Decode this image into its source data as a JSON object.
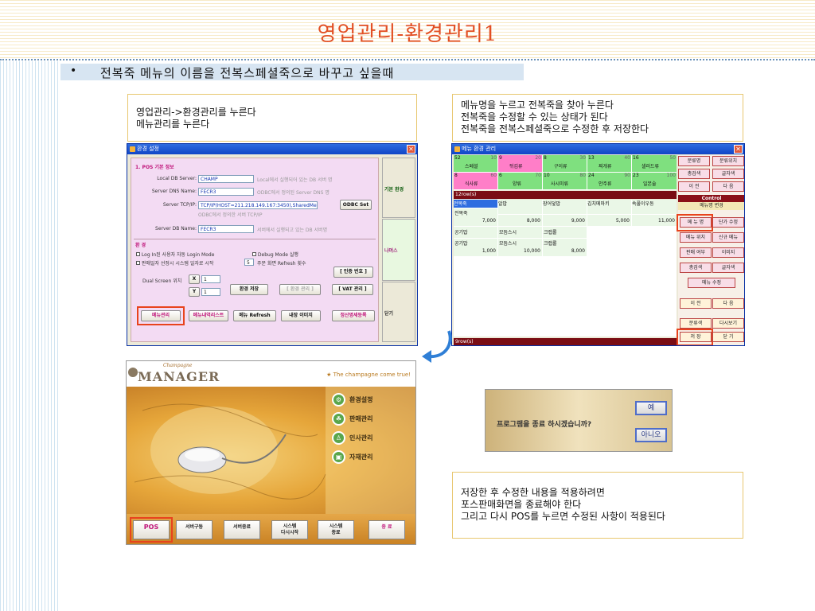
{
  "slide": {
    "title": "영업관리-환경관리1",
    "bullet": "•",
    "bullet_text": "전복죽 메뉴의 이름을 전복스페셜죽으로 바꾸고 싶을때"
  },
  "note_left": {
    "line1": "영업관리->환경관리를 누른다",
    "line2": "메뉴관리를 누른다"
  },
  "note_right": {
    "line1": "메뉴명을 누르고 전복죽을 찾아 누른다",
    "line2": "전복죽을 수정할 수 있는 상태가 된다",
    "line3": "전복죽을 전복스페셜죽으로 수정한 후 저장한다"
  },
  "note_bottom": {
    "line1": "저장한 후 수정한 내용을 적용하려면",
    "line2": "포스판매화면을 종료해야 한다",
    "line3": "그리고 다시 POS를 누르면 수정된 사항이 적용된다"
  },
  "env_window": {
    "title": "환경 설정",
    "section1": "1. POS 기본 정보",
    "local_db_label": "Local DB Server:",
    "local_db_value": "CHAMP",
    "local_db_hint": "Local에서 실행되어 있는 DB 서버 명",
    "dsn_label": "Server DNS Name:",
    "dsn_value": "FECR3",
    "dsn_hint": "ODBC에서 정의된 Server DNS 명",
    "tcp_label": "Server TCP/IP:",
    "tcp_value": "TCP/IP(HOST=211.218.149.167:3450),SharedMemory)",
    "tcp_hint": "ODBC에서 정의한 서버 TCP/IP",
    "odbc_btn": "ODBC Set",
    "dbname_label": "Server DB Name:",
    "dbname_value": "FECR3",
    "dbname_hint": "서버에서 실행되고 있는 DB 서버명",
    "section2": "환 경",
    "opt1": "Log In된 사용자 자동 Login Mode",
    "opt2": "Debug Mode 실행",
    "opt3": "판매일자 선정시 시스템 일자로 시작",
    "opt4_num": "5",
    "opt4": "주문 화면 Refresh 횟수",
    "dual_label": "Dual Screen 위치",
    "x_label": "X",
    "x_value": "1",
    "y_label": "Y",
    "y_value": "1",
    "btn_auth": "[ 인증 번호 ]",
    "btn_save": "환경 저장",
    "btn_apply": "[ 환경 관리 ]",
    "btn_vat": "[ VAT 관리 ]",
    "btn_menu": "메뉴관리",
    "btn_menulist": "메뉴내역리스트",
    "btn_refresh": "메뉴 Refresh",
    "btn_image": "내장 이미지",
    "btn_settle": "정산명세등록",
    "side_basic": "기본 환경",
    "side_other": "나머스",
    "side_close": "닫기"
  },
  "menu_window": {
    "title": "메뉴 환경 관리",
    "categories": [
      {
        "num": "52",
        "code": "10",
        "name": "스페셜"
      },
      {
        "num": "9",
        "code": "20",
        "name": "뒤김류"
      },
      {
        "num": "8",
        "code": "30",
        "name": "구이류"
      },
      {
        "num": "13",
        "code": "40",
        "name": "찌개류"
      },
      {
        "num": "16",
        "code": "50",
        "name": "샐러드류"
      },
      {
        "num": "8",
        "code": "60",
        "name": "식사류"
      },
      {
        "num": "6",
        "code": "70",
        "name": "양류"
      },
      {
        "num": "10",
        "code": "80",
        "name": "사시미류"
      },
      {
        "num": "24",
        "code": "90",
        "name": "안주류"
      },
      {
        "num": "23",
        "code": "100",
        "name": "일본술"
      }
    ],
    "row_label_top": "12row(s)",
    "items": [
      {
        "name": "전복죽",
        "price": "7,000"
      },
      {
        "name": "알밥",
        "price": "8,000"
      },
      {
        "name": "장어덮밥",
        "price": "9,000"
      },
      {
        "name": "김치메마키",
        "price": "5,000"
      },
      {
        "name": "속풀이우동",
        "price": "11,000"
      },
      {
        "name": "공기밥",
        "price": ""
      },
      {
        "name": "모듬스시",
        "price": "10,000"
      },
      {
        "name": "크랩롤",
        "price": "8,000"
      },
      {
        "name": "공기밥",
        "price": "1,000"
      }
    ],
    "row_label_bottom": "9row(s)",
    "control_title": "Control",
    "control_sub": "메뉴명 변경",
    "buttons": [
      "분류명",
      "분류위치",
      "총검색",
      "글자색",
      "이 전",
      "다 음",
      "메 뉴 명",
      "단가 수정",
      "메뉴 위치",
      "신규 메뉴",
      "판매 여부",
      "이미지",
      "총검색",
      "글자색",
      "메뉴 수정",
      "이 전",
      "다 음",
      "분류색",
      "다시보기",
      "저 장",
      "닫 기"
    ]
  },
  "manager": {
    "logo": "MANAGER",
    "logo_small": "Champagne",
    "tagline": "★ The champagne come true!",
    "items": [
      "환경설정",
      "판매관리",
      "인사관리",
      "자재관리"
    ],
    "bottom_buttons": [
      "POS",
      "서버구동",
      "서버종료",
      "시스템\n다시시작",
      "시스템\n종료",
      "종 료"
    ]
  },
  "dialog": {
    "message": "프로그램을 종료 하시겠습니까?",
    "yes": "예",
    "no": "아니오"
  },
  "colors": {
    "title": "#e24f24",
    "highlight": "#e8431d",
    "accent_blue": "#1045c6"
  }
}
